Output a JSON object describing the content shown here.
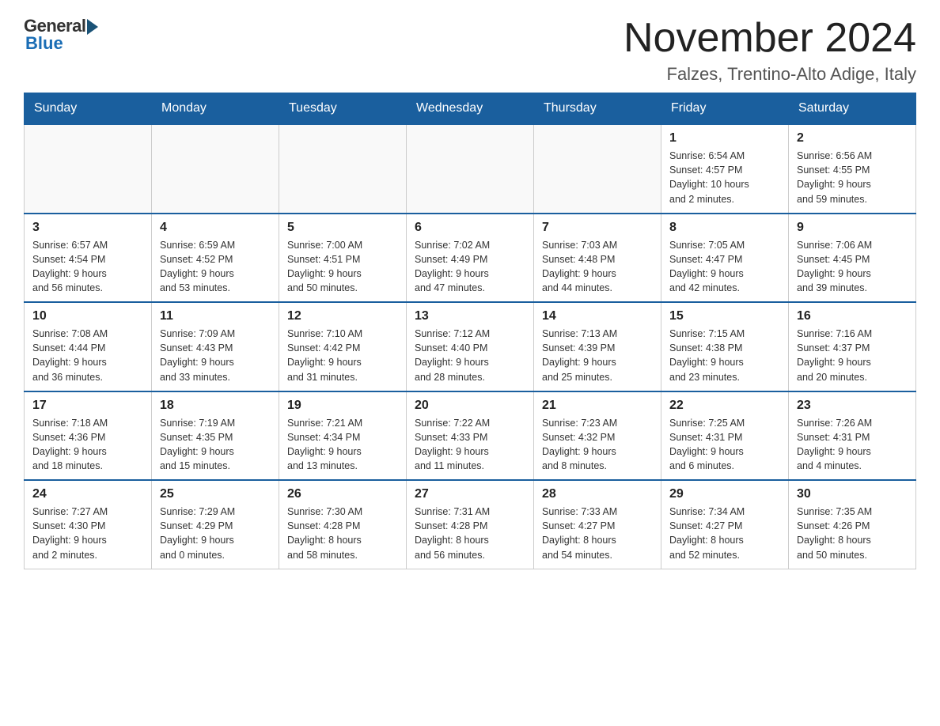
{
  "header": {
    "logo_general": "General",
    "logo_blue": "Blue",
    "month_title": "November 2024",
    "location": "Falzes, Trentino-Alto Adige, Italy"
  },
  "days_of_week": [
    "Sunday",
    "Monday",
    "Tuesday",
    "Wednesday",
    "Thursday",
    "Friday",
    "Saturday"
  ],
  "weeks": [
    [
      {
        "day": "",
        "info": ""
      },
      {
        "day": "",
        "info": ""
      },
      {
        "day": "",
        "info": ""
      },
      {
        "day": "",
        "info": ""
      },
      {
        "day": "",
        "info": ""
      },
      {
        "day": "1",
        "info": "Sunrise: 6:54 AM\nSunset: 4:57 PM\nDaylight: 10 hours\nand 2 minutes."
      },
      {
        "day": "2",
        "info": "Sunrise: 6:56 AM\nSunset: 4:55 PM\nDaylight: 9 hours\nand 59 minutes."
      }
    ],
    [
      {
        "day": "3",
        "info": "Sunrise: 6:57 AM\nSunset: 4:54 PM\nDaylight: 9 hours\nand 56 minutes."
      },
      {
        "day": "4",
        "info": "Sunrise: 6:59 AM\nSunset: 4:52 PM\nDaylight: 9 hours\nand 53 minutes."
      },
      {
        "day": "5",
        "info": "Sunrise: 7:00 AM\nSunset: 4:51 PM\nDaylight: 9 hours\nand 50 minutes."
      },
      {
        "day": "6",
        "info": "Sunrise: 7:02 AM\nSunset: 4:49 PM\nDaylight: 9 hours\nand 47 minutes."
      },
      {
        "day": "7",
        "info": "Sunrise: 7:03 AM\nSunset: 4:48 PM\nDaylight: 9 hours\nand 44 minutes."
      },
      {
        "day": "8",
        "info": "Sunrise: 7:05 AM\nSunset: 4:47 PM\nDaylight: 9 hours\nand 42 minutes."
      },
      {
        "day": "9",
        "info": "Sunrise: 7:06 AM\nSunset: 4:45 PM\nDaylight: 9 hours\nand 39 minutes."
      }
    ],
    [
      {
        "day": "10",
        "info": "Sunrise: 7:08 AM\nSunset: 4:44 PM\nDaylight: 9 hours\nand 36 minutes."
      },
      {
        "day": "11",
        "info": "Sunrise: 7:09 AM\nSunset: 4:43 PM\nDaylight: 9 hours\nand 33 minutes."
      },
      {
        "day": "12",
        "info": "Sunrise: 7:10 AM\nSunset: 4:42 PM\nDaylight: 9 hours\nand 31 minutes."
      },
      {
        "day": "13",
        "info": "Sunrise: 7:12 AM\nSunset: 4:40 PM\nDaylight: 9 hours\nand 28 minutes."
      },
      {
        "day": "14",
        "info": "Sunrise: 7:13 AM\nSunset: 4:39 PM\nDaylight: 9 hours\nand 25 minutes."
      },
      {
        "day": "15",
        "info": "Sunrise: 7:15 AM\nSunset: 4:38 PM\nDaylight: 9 hours\nand 23 minutes."
      },
      {
        "day": "16",
        "info": "Sunrise: 7:16 AM\nSunset: 4:37 PM\nDaylight: 9 hours\nand 20 minutes."
      }
    ],
    [
      {
        "day": "17",
        "info": "Sunrise: 7:18 AM\nSunset: 4:36 PM\nDaylight: 9 hours\nand 18 minutes."
      },
      {
        "day": "18",
        "info": "Sunrise: 7:19 AM\nSunset: 4:35 PM\nDaylight: 9 hours\nand 15 minutes."
      },
      {
        "day": "19",
        "info": "Sunrise: 7:21 AM\nSunset: 4:34 PM\nDaylight: 9 hours\nand 13 minutes."
      },
      {
        "day": "20",
        "info": "Sunrise: 7:22 AM\nSunset: 4:33 PM\nDaylight: 9 hours\nand 11 minutes."
      },
      {
        "day": "21",
        "info": "Sunrise: 7:23 AM\nSunset: 4:32 PM\nDaylight: 9 hours\nand 8 minutes."
      },
      {
        "day": "22",
        "info": "Sunrise: 7:25 AM\nSunset: 4:31 PM\nDaylight: 9 hours\nand 6 minutes."
      },
      {
        "day": "23",
        "info": "Sunrise: 7:26 AM\nSunset: 4:31 PM\nDaylight: 9 hours\nand 4 minutes."
      }
    ],
    [
      {
        "day": "24",
        "info": "Sunrise: 7:27 AM\nSunset: 4:30 PM\nDaylight: 9 hours\nand 2 minutes."
      },
      {
        "day": "25",
        "info": "Sunrise: 7:29 AM\nSunset: 4:29 PM\nDaylight: 9 hours\nand 0 minutes."
      },
      {
        "day": "26",
        "info": "Sunrise: 7:30 AM\nSunset: 4:28 PM\nDaylight: 8 hours\nand 58 minutes."
      },
      {
        "day": "27",
        "info": "Sunrise: 7:31 AM\nSunset: 4:28 PM\nDaylight: 8 hours\nand 56 minutes."
      },
      {
        "day": "28",
        "info": "Sunrise: 7:33 AM\nSunset: 4:27 PM\nDaylight: 8 hours\nand 54 minutes."
      },
      {
        "day": "29",
        "info": "Sunrise: 7:34 AM\nSunset: 4:27 PM\nDaylight: 8 hours\nand 52 minutes."
      },
      {
        "day": "30",
        "info": "Sunrise: 7:35 AM\nSunset: 4:26 PM\nDaylight: 8 hours\nand 50 minutes."
      }
    ]
  ]
}
